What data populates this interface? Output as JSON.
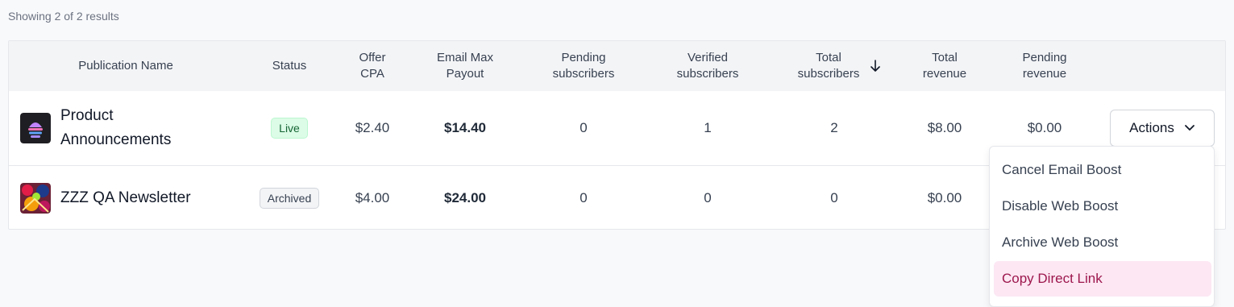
{
  "results_text": "Showing 2 of 2 results",
  "columns": {
    "publication_name": "Publication Name",
    "status": "Status",
    "offer_cpa": "Offer\nCPA",
    "email_max_payout": "Email Max\nPayout",
    "pending_subscribers": "Pending\nsubscribers",
    "verified_subscribers": "Verified\nsubscribers",
    "total_subscribers": "Total\nsubscribers",
    "total_revenue": "Total\nrevenue",
    "pending_revenue": "Pending\nrevenue"
  },
  "rows": [
    {
      "name": "Product Announcements",
      "status": "Live",
      "offer_cpa": "$2.40",
      "email_max_payout": "$14.40",
      "pending_subscribers": "0",
      "verified_subscribers": "1",
      "total_subscribers": "2",
      "total_revenue": "$8.00",
      "pending_revenue": "$0.00",
      "actions_label": "Actions"
    },
    {
      "name": "ZZZ QA Newsletter",
      "status": "Archived",
      "offer_cpa": "$4.00",
      "email_max_payout": "$24.00",
      "pending_subscribers": "0",
      "verified_subscribers": "0",
      "total_subscribers": "0",
      "total_revenue": "$0.00"
    }
  ],
  "actions_menu": {
    "items": [
      "Cancel Email Boost",
      "Disable Web Boost",
      "Archive Web Boost",
      "Copy Direct Link"
    ],
    "highlighted_index": 3
  },
  "colors": {
    "live_badge": "#dcfce7",
    "highlight": "#fce7f3",
    "highlight_text": "#9d174d"
  }
}
